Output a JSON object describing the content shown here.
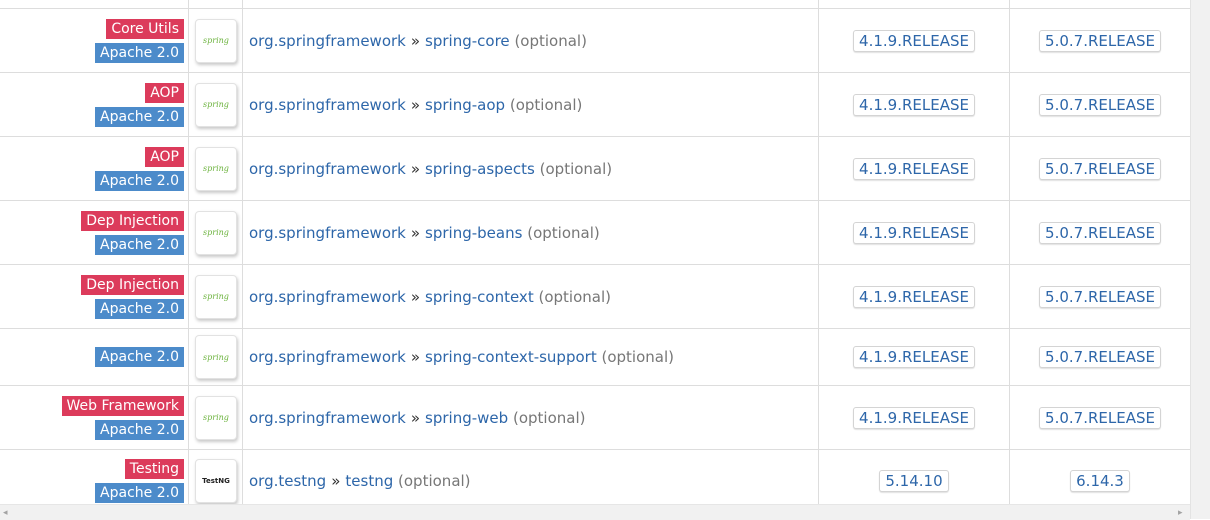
{
  "rows": [
    {
      "category": "Core Utils",
      "license": "Apache 2.0",
      "logo": "spring",
      "group": "org.springframework",
      "separator": "»",
      "artifact": "spring-core",
      "scope": "(optional)",
      "version_a": "4.1.9.RELEASE",
      "version_b": "5.0.7.RELEASE"
    },
    {
      "category": "AOP",
      "license": "Apache 2.0",
      "logo": "spring",
      "group": "org.springframework",
      "separator": "»",
      "artifact": "spring-aop",
      "scope": "(optional)",
      "version_a": "4.1.9.RELEASE",
      "version_b": "5.0.7.RELEASE"
    },
    {
      "category": "AOP",
      "license": "Apache 2.0",
      "logo": "spring",
      "group": "org.springframework",
      "separator": "»",
      "artifact": "spring-aspects",
      "scope": "(optional)",
      "version_a": "4.1.9.RELEASE",
      "version_b": "5.0.7.RELEASE"
    },
    {
      "category": "Dep Injection",
      "license": "Apache 2.0",
      "logo": "spring",
      "group": "org.springframework",
      "separator": "»",
      "artifact": "spring-beans",
      "scope": "(optional)",
      "version_a": "4.1.9.RELEASE",
      "version_b": "5.0.7.RELEASE"
    },
    {
      "category": "Dep Injection",
      "license": "Apache 2.0",
      "logo": "spring",
      "group": "org.springframework",
      "separator": "»",
      "artifact": "spring-context",
      "scope": "(optional)",
      "version_a": "4.1.9.RELEASE",
      "version_b": "5.0.7.RELEASE"
    },
    {
      "category": "",
      "license": "Apache 2.0",
      "logo": "spring",
      "group": "org.springframework",
      "separator": "»",
      "artifact": "spring-context-support",
      "scope": "(optional)",
      "version_a": "4.1.9.RELEASE",
      "version_b": "5.0.7.RELEASE"
    },
    {
      "category": "Web Framework",
      "license": "Apache 2.0",
      "logo": "spring",
      "group": "org.springframework",
      "separator": "»",
      "artifact": "spring-web",
      "scope": "(optional)",
      "version_a": "4.1.9.RELEASE",
      "version_b": "5.0.7.RELEASE"
    },
    {
      "category": "Testing",
      "license": "Apache 2.0",
      "logo": "testng",
      "group": "org.testng",
      "separator": "»",
      "artifact": "testng",
      "scope": "(optional)",
      "version_a": "5.14.10",
      "version_b": "6.14.3"
    }
  ],
  "logo_text": {
    "spring": "spring",
    "testng": "TestNG"
  },
  "colors": {
    "category_bg": "#dc3b5b",
    "license_bg": "#4c8bca",
    "link": "#2d66a9",
    "spring_green": "#6db33f"
  },
  "scrollbar": {
    "left_arrow": "◂",
    "right_arrow": "▸"
  }
}
